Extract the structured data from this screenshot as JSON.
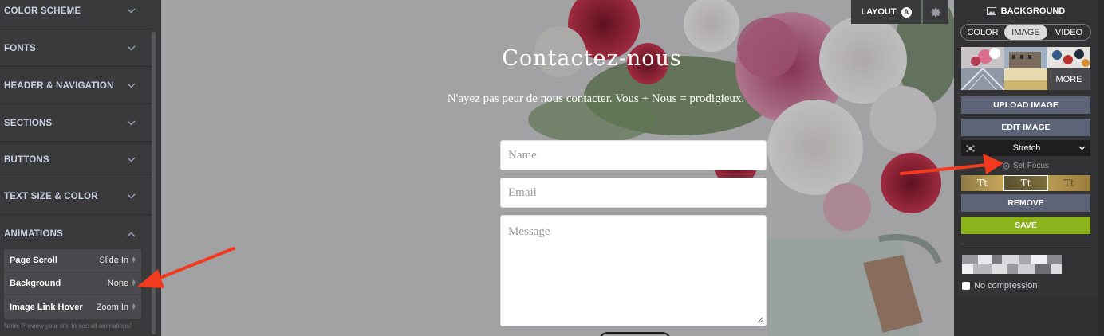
{
  "sidebar": {
    "sections": [
      {
        "label": "COLOR SCHEME",
        "expanded": false
      },
      {
        "label": "FONTS",
        "expanded": false
      },
      {
        "label": "HEADER & NAVIGATION",
        "expanded": false
      },
      {
        "label": "SECTIONS",
        "expanded": false
      },
      {
        "label": "BUTTONS",
        "expanded": false
      },
      {
        "label": "TEXT SIZE & COLOR",
        "expanded": false
      },
      {
        "label": "ANIMATIONS",
        "expanded": true
      }
    ],
    "animations": [
      {
        "label": "Page Scroll",
        "value": "Slide In"
      },
      {
        "label": "Background",
        "value": "None"
      },
      {
        "label": "Image Link Hover",
        "value": "Zoom In"
      }
    ],
    "note": "Note: Preview your site to see all animations!"
  },
  "page": {
    "title": "Contactez-nous",
    "subtitle": "N'ayez pas peur de nous contacter. Vous + Nous = prodigieux.",
    "name_placeholder": "Name",
    "email_placeholder": "Email",
    "message_placeholder": "Message"
  },
  "toolbar": {
    "layout_label": "LAYOUT",
    "layout_badge": "A",
    "settings_icon": "gear-icon"
  },
  "panel": {
    "title": "BACKGROUND",
    "tabs": [
      {
        "label": "COLOR",
        "active": false
      },
      {
        "label": "IMAGE",
        "active": true
      },
      {
        "label": "VIDEO",
        "active": false
      }
    ],
    "more_label": "MORE",
    "upload_label": "UPLOAD IMAGE",
    "edit_label": "EDIT IMAGE",
    "stretch_value": "Stretch",
    "set_focus_label": "Set Focus",
    "text_style_samples": [
      "Tt",
      "Tt",
      "Tt"
    ],
    "remove_label": "REMOVE",
    "save_label": "SAVE",
    "no_compression_label": "No compression",
    "no_compression_checked": false
  },
  "colors": {
    "accent_arrow": "#f23a1f",
    "save_green": "#8cb31c",
    "button_slate": "#5d6478",
    "sidebar_bg": "#3a3a3c"
  }
}
